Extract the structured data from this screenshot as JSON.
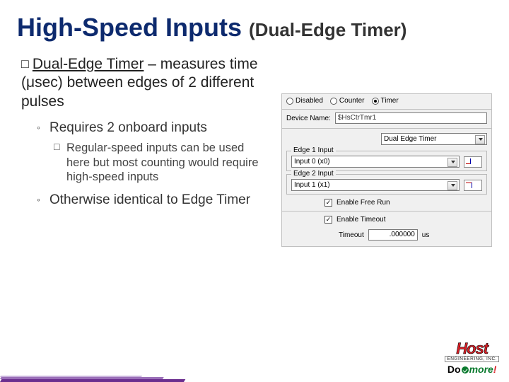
{
  "title": {
    "main": "High-Speed Inputs",
    "sub": "(Dual-Edge Timer)"
  },
  "bullets": {
    "lvl1_term": "Dual-Edge Timer",
    "lvl1_rest": " – measures time (μsec) between edges of 2 different pulses",
    "lvl2a": "Requires 2 onboard inputs",
    "lvl3a": "Regular-speed inputs can be used here but most counting would require high-speed inputs",
    "lvl2b": "Otherwise identical to Edge Timer"
  },
  "dialog": {
    "radios": {
      "disabled": "Disabled",
      "counter": "Counter",
      "timer": "Timer",
      "selected": "timer"
    },
    "device_name_label": "Device Name:",
    "device_name_value": "$HsCtrTmr1",
    "mode_value": "Dual Edge Timer",
    "edge1": {
      "legend": "Edge 1 Input",
      "value": "Input 0 (x0)"
    },
    "edge2": {
      "legend": "Edge 2 Input",
      "value": "Input 1 (x1)"
    },
    "freerun_label": "Enable Free Run",
    "freerun_checked": true,
    "timeout_enable_label": "Enable Timeout",
    "timeout_enable_checked": true,
    "timeout_label": "Timeout",
    "timeout_value": ".000000",
    "timeout_unit": "us"
  },
  "logos": {
    "host": "Host",
    "host_sub": "ENGINEERING, INC.",
    "domore_do": "Do",
    "domore_more": "more",
    "domore_bang": "!"
  }
}
